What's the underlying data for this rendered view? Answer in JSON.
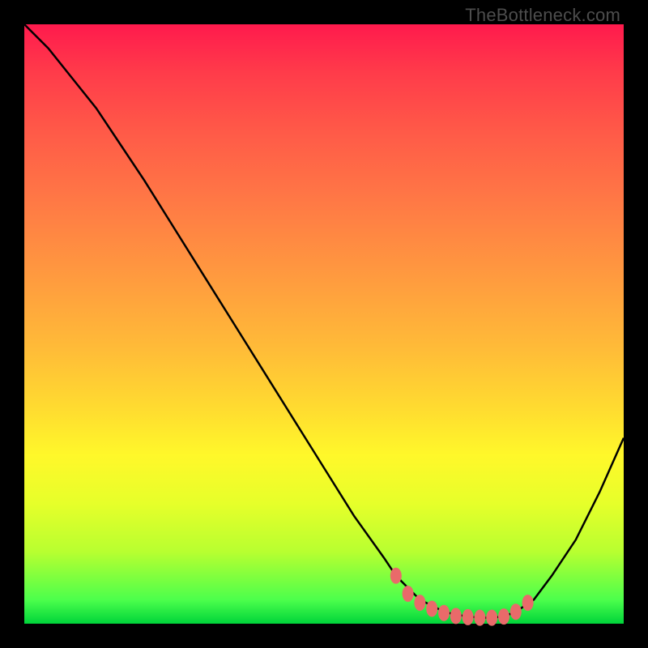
{
  "watermark": "TheBottleneck.com",
  "colors": {
    "background": "#000000",
    "curve_stroke": "#000000",
    "marker_fill": "#e96a6a",
    "gradient_top": "#ff1a4d",
    "gradient_bottom": "#00d43a"
  },
  "chart_data": {
    "type": "line",
    "title": "",
    "xlabel": "",
    "ylabel": "",
    "xlim": [
      0,
      100
    ],
    "ylim": [
      0,
      100
    ],
    "grid": false,
    "legend": false,
    "series": [
      {
        "name": "curve",
        "x": [
          0,
          4,
          8,
          12,
          16,
          20,
          25,
          30,
          35,
          40,
          45,
          50,
          55,
          60,
          62,
          64,
          66,
          68,
          70,
          72,
          74,
          76,
          78,
          80,
          82,
          85,
          88,
          92,
          96,
          100
        ],
        "y": [
          100,
          96,
          91,
          86,
          80,
          74,
          66,
          58,
          50,
          42,
          34,
          26,
          18,
          11,
          8,
          6,
          4,
          3,
          2,
          1.5,
          1.2,
          1,
          1,
          1.2,
          2,
          4,
          8,
          14,
          22,
          31
        ]
      }
    ],
    "markers": {
      "name": "flat-bottom",
      "x": [
        62,
        64,
        66,
        68,
        70,
        72,
        74,
        76,
        78,
        80,
        82,
        84
      ],
      "y": [
        8,
        5,
        3.5,
        2.5,
        1.8,
        1.3,
        1.1,
        1,
        1,
        1.2,
        2,
        3.5
      ]
    }
  }
}
